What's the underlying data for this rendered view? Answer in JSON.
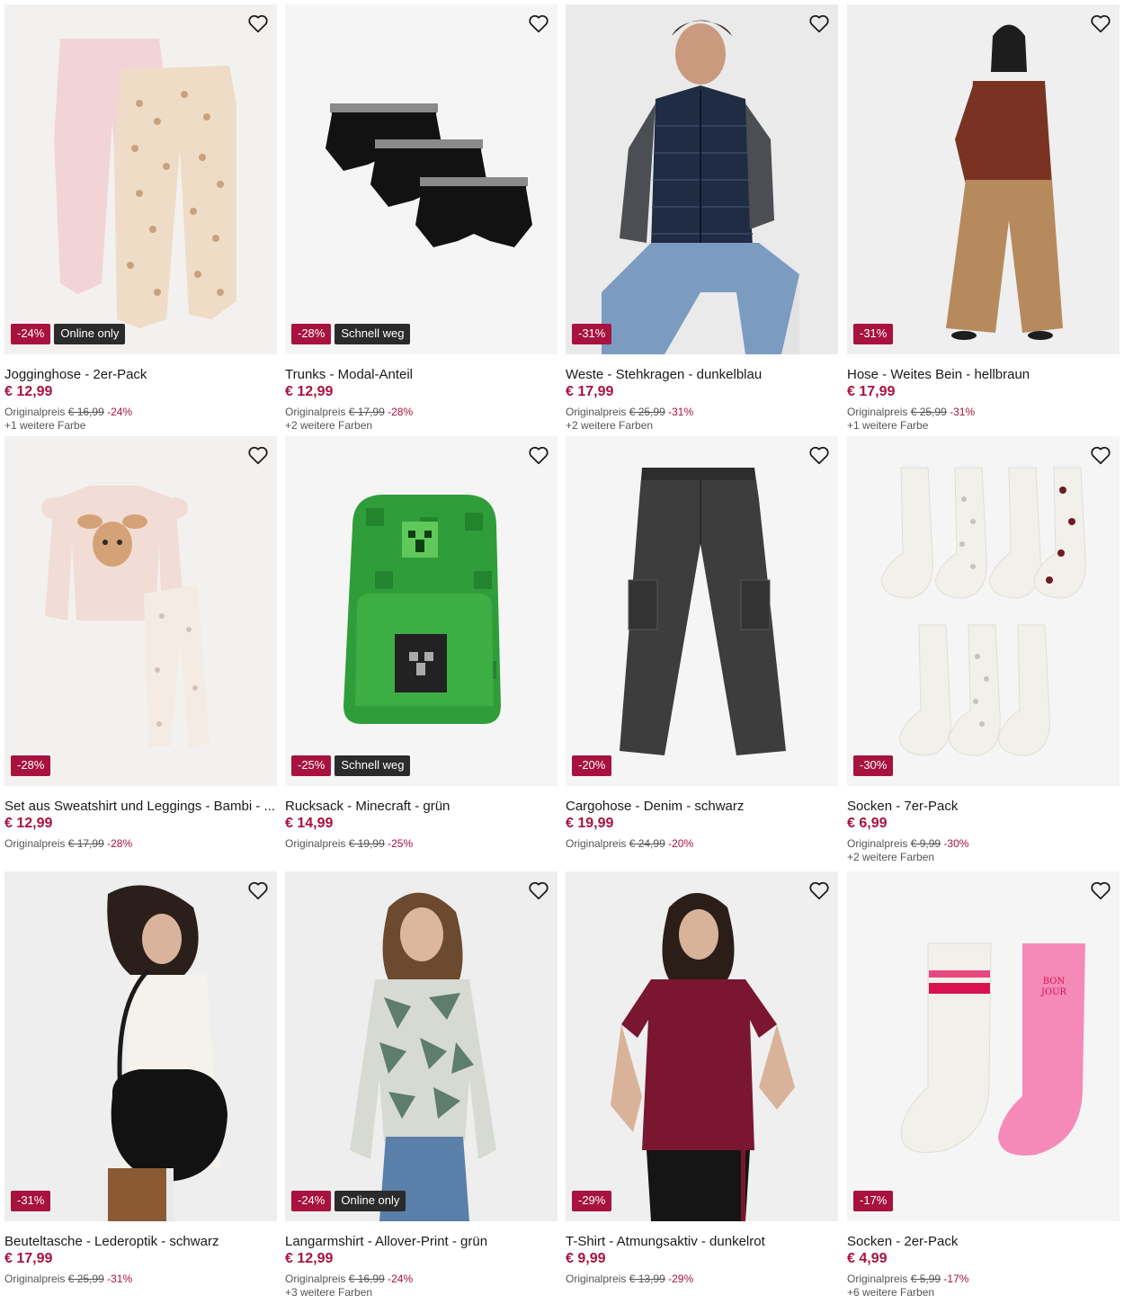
{
  "colors": {
    "sale": "#a8123e",
    "tag": "#2b2b2b",
    "price": "#a8123e"
  },
  "products": [
    {
      "title": "Jogginghose - 2er-Pack",
      "price": "€ 12,99",
      "orig_label": "Originalpreis",
      "orig_price": "€ 16,99",
      "discount": "-24%",
      "badge": "-24%",
      "tag": "Online only",
      "more": "+1 weitere Farbe",
      "favorite_icon": "heart-outline-icon"
    },
    {
      "title": "Trunks - Modal-Anteil",
      "price": "€ 12,99",
      "orig_label": "Originalpreis",
      "orig_price": "€ 17,99",
      "discount": "-28%",
      "badge": "-28%",
      "tag": "Schnell weg",
      "more": "+2 weitere Farben",
      "favorite_icon": "heart-outline-icon"
    },
    {
      "title": "Weste - Stehkragen - dunkelblau",
      "price": "€ 17,99",
      "orig_label": "Originalpreis",
      "orig_price": "€ 25,99",
      "discount": "-31%",
      "badge": "-31%",
      "tag": "",
      "more": "+2 weitere Farben",
      "favorite_icon": "heart-outline-icon"
    },
    {
      "title": "Hose - Weites Bein - hellbraun",
      "price": "€ 17,99",
      "orig_label": "Originalpreis",
      "orig_price": "€ 25,99",
      "discount": "-31%",
      "badge": "-31%",
      "tag": "",
      "more": "+1 weitere Farbe",
      "favorite_icon": "heart-outline-icon"
    },
    {
      "title": "Set aus Sweatshirt und Leggings - Bambi - ...",
      "price": "€ 12,99",
      "orig_label": "Originalpreis",
      "orig_price": "€ 17,99",
      "discount": "-28%",
      "badge": "-28%",
      "tag": "",
      "more": "",
      "favorite_icon": "heart-outline-icon"
    },
    {
      "title": "Rucksack - Minecraft - grün",
      "price": "€ 14,99",
      "orig_label": "Originalpreis",
      "orig_price": "€ 19,99",
      "discount": "-25%",
      "badge": "-25%",
      "tag": "Schnell weg",
      "more": "",
      "favorite_icon": "heart-outline-icon"
    },
    {
      "title": "Cargohose - Denim - schwarz",
      "price": "€ 19,99",
      "orig_label": "Originalpreis",
      "orig_price": "€ 24,99",
      "discount": "-20%",
      "badge": "-20%",
      "tag": "",
      "more": "",
      "favorite_icon": "heart-outline-icon"
    },
    {
      "title": "Socken - 7er-Pack",
      "price": "€ 6,99",
      "orig_label": "Originalpreis",
      "orig_price": "€ 9,99",
      "discount": "-30%",
      "badge": "-30%",
      "tag": "",
      "more": "+2 weitere Farben",
      "favorite_icon": "heart-outline-icon"
    },
    {
      "title": "Beuteltasche - Lederoptik - schwarz",
      "price": "€ 17,99",
      "orig_label": "Originalpreis",
      "orig_price": "€ 25,99",
      "discount": "-31%",
      "badge": "-31%",
      "tag": "",
      "more": "",
      "favorite_icon": "heart-outline-icon"
    },
    {
      "title": "Langarmshirt - Allover-Print - grün",
      "price": "€ 12,99",
      "orig_label": "Originalpreis",
      "orig_price": "€ 16,99",
      "discount": "-24%",
      "badge": "-24%",
      "tag": "Online only",
      "more": "+3 weitere Farben",
      "favorite_icon": "heart-outline-icon"
    },
    {
      "title": "T-Shirt - Atmungsaktiv - dunkelrot",
      "price": "€ 9,99",
      "orig_label": "Originalpreis",
      "orig_price": "€ 13,99",
      "discount": "-29%",
      "badge": "-29%",
      "tag": "",
      "more": "",
      "favorite_icon": "heart-outline-icon"
    },
    {
      "title": "Socken - 2er-Pack",
      "price": "€ 4,99",
      "orig_label": "Originalpreis",
      "orig_price": "€ 5,99",
      "discount": "-17%",
      "badge": "-17%",
      "tag": "",
      "more": "+6 weitere Farben",
      "favorite_icon": "heart-outline-icon"
    }
  ]
}
